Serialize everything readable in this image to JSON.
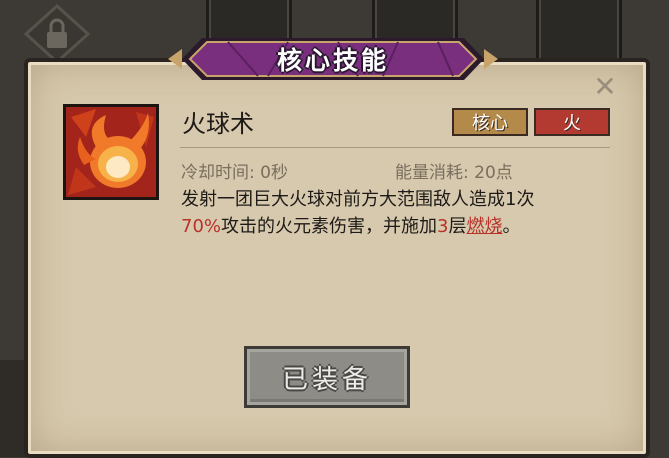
{
  "dialog": {
    "title": "核心技能",
    "close_label": "✕"
  },
  "skill": {
    "name": "火球术",
    "icon": "fireball-icon",
    "tags": [
      {
        "label": "核心",
        "color": "#b48a4a"
      },
      {
        "label": "火",
        "color": "#b33a30"
      }
    ],
    "cooldown_label": "冷却时间: 0秒",
    "energy_label": "能量消耗: 20点",
    "description": {
      "line1": "发射一团巨大火球对前方大范围敌人造成1次",
      "line2_highlight": "70%",
      "line2_mid": "攻击的火元素伤害，并施加",
      "line2_count": "3",
      "line2_unit": "层",
      "line2_link": "燃烧",
      "line2_end": "。"
    }
  },
  "equip_button": {
    "label": "已装备"
  },
  "colors": {
    "parchment": "#d7c9ad",
    "banner_purple": "#6a2a6e",
    "highlight_red": "#b8322a",
    "button_gray": "#8e8c87"
  }
}
